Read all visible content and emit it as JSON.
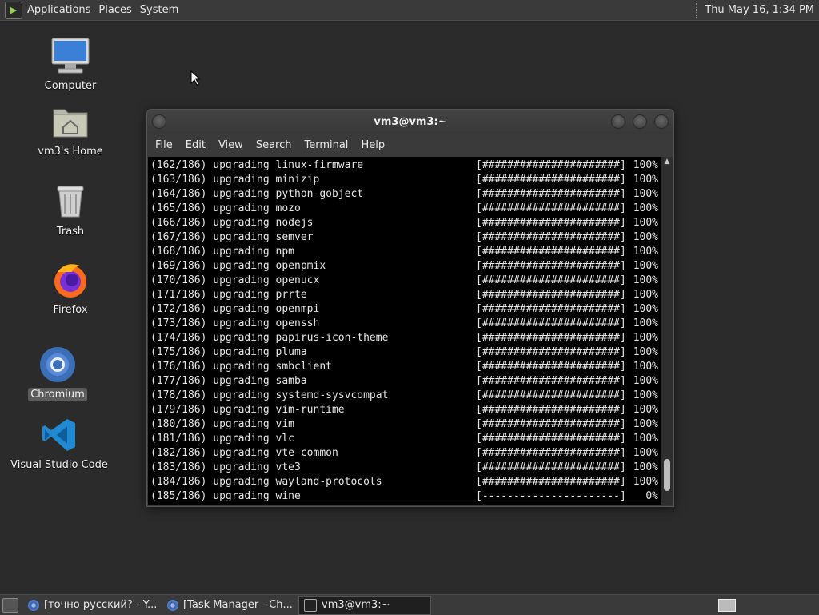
{
  "top_panel": {
    "menus": [
      "Applications",
      "Places",
      "System"
    ],
    "clock": "Thu May 16,  1:34 PM"
  },
  "desktop_icons": [
    {
      "label": "Computer",
      "icon": "computer-icon"
    },
    {
      "label": "vm3's Home",
      "icon": "home-folder-icon"
    },
    {
      "label": "Trash",
      "icon": "trash-icon"
    },
    {
      "label": "Firefox",
      "icon": "firefox-icon"
    },
    {
      "label": "Chromium",
      "icon": "chromium-icon",
      "selected": true
    },
    {
      "label": "Visual Studio Code",
      "icon": "vscode-icon"
    }
  ],
  "terminal": {
    "title": "vm3@vm3:~",
    "menu": [
      "File",
      "Edit",
      "View",
      "Search",
      "Terminal",
      "Help"
    ],
    "lines": [
      {
        "left": "(162/186) upgrading linux-firmware",
        "bar": "[######################]",
        "pct": "100%"
      },
      {
        "left": "(163/186) upgrading minizip",
        "bar": "[######################]",
        "pct": "100%"
      },
      {
        "left": "(164/186) upgrading python-gobject",
        "bar": "[######################]",
        "pct": "100%"
      },
      {
        "left": "(165/186) upgrading mozo",
        "bar": "[######################]",
        "pct": "100%"
      },
      {
        "left": "(166/186) upgrading nodejs",
        "bar": "[######################]",
        "pct": "100%"
      },
      {
        "left": "(167/186) upgrading semver",
        "bar": "[######################]",
        "pct": "100%"
      },
      {
        "left": "(168/186) upgrading npm",
        "bar": "[######################]",
        "pct": "100%"
      },
      {
        "left": "(169/186) upgrading openpmix",
        "bar": "[######################]",
        "pct": "100%"
      },
      {
        "left": "(170/186) upgrading openucx",
        "bar": "[######################]",
        "pct": "100%"
      },
      {
        "left": "(171/186) upgrading prrte",
        "bar": "[######################]",
        "pct": "100%"
      },
      {
        "left": "(172/186) upgrading openmpi",
        "bar": "[######################]",
        "pct": "100%"
      },
      {
        "left": "(173/186) upgrading openssh",
        "bar": "[######################]",
        "pct": "100%"
      },
      {
        "left": "(174/186) upgrading papirus-icon-theme",
        "bar": "[######################]",
        "pct": "100%"
      },
      {
        "left": "(175/186) upgrading pluma",
        "bar": "[######################]",
        "pct": "100%"
      },
      {
        "left": "(176/186) upgrading smbclient",
        "bar": "[######################]",
        "pct": "100%"
      },
      {
        "left": "(177/186) upgrading samba",
        "bar": "[######################]",
        "pct": "100%"
      },
      {
        "left": "(178/186) upgrading systemd-sysvcompat",
        "bar": "[######################]",
        "pct": "100%"
      },
      {
        "left": "(179/186) upgrading vim-runtime",
        "bar": "[######################]",
        "pct": "100%"
      },
      {
        "left": "(180/186) upgrading vim",
        "bar": "[######################]",
        "pct": "100%"
      },
      {
        "left": "(181/186) upgrading vlc",
        "bar": "[######################]",
        "pct": "100%"
      },
      {
        "left": "(182/186) upgrading vte-common",
        "bar": "[######################]",
        "pct": "100%"
      },
      {
        "left": "(183/186) upgrading vte3",
        "bar": "[######################]",
        "pct": "100%"
      },
      {
        "left": "(184/186) upgrading wayland-protocols",
        "bar": "[######################]",
        "pct": "100%"
      },
      {
        "left": "(185/186) upgrading wine",
        "bar": "[----------------------]",
        "pct": "0%"
      }
    ]
  },
  "taskbar": {
    "tasks": [
      {
        "label": "[точно русский? - Y...",
        "icon": "browser-icon",
        "active": false
      },
      {
        "label": "[Task Manager - Ch...",
        "icon": "browser-icon",
        "active": false
      },
      {
        "label": "vm3@vm3:~",
        "icon": "terminal-icon",
        "active": true
      }
    ]
  },
  "colors": {
    "desktop_bg": "#2b2b2b",
    "panel_bg": "#3a3a3a",
    "terminal_bg": "#000000",
    "terminal_fg": "#e6e6e6"
  }
}
